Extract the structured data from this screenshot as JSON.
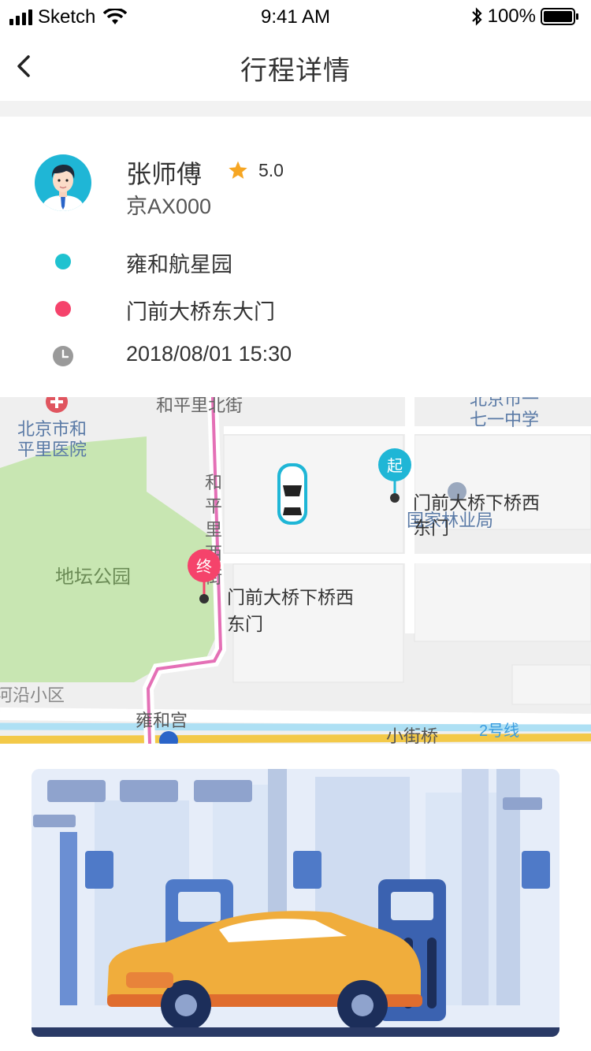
{
  "status_bar": {
    "carrier": "Sketch",
    "time": "9:41 AM",
    "battery": "100%"
  },
  "nav": {
    "title": "行程详情",
    "back_icon": "chevron-left-icon"
  },
  "driver": {
    "name": "张师傅",
    "rating": "5.0",
    "plate": "京AX000"
  },
  "trip": {
    "origin": "雍和航星园",
    "destination": "门前大桥东大门",
    "datetime": "2018/08/01  15:30",
    "colors": {
      "origin": "#1fc2d0",
      "destination": "#f5436b",
      "time_icon": "#9a9a9a"
    }
  },
  "map": {
    "start_marker": "起",
    "end_marker": "终",
    "start_label_line1": "门前大桥下桥西",
    "start_label_line2": "东门",
    "end_label_line1": "门前大桥下桥西",
    "end_label_line2": "东门",
    "places": {
      "hospital_line1": "北京市和",
      "hospital_line2": "平里医院",
      "street_north": "和平里北街",
      "school_line1": "北京市一",
      "school_line2": "七一中学",
      "forestry": "国家林业局",
      "park": "地坛公园",
      "river": "河沿小区",
      "yonghe": "雍和宫",
      "xiaojieqiao": "小街桥",
      "metro": "2号线",
      "heping_west_1": "和",
      "heping_west_2": "平",
      "heping_west_3": "里",
      "heping_west_4": "西",
      "heping_west_5": "街"
    }
  },
  "banner": {
    "illustration": "taxi-at-charging-station-illustration"
  }
}
